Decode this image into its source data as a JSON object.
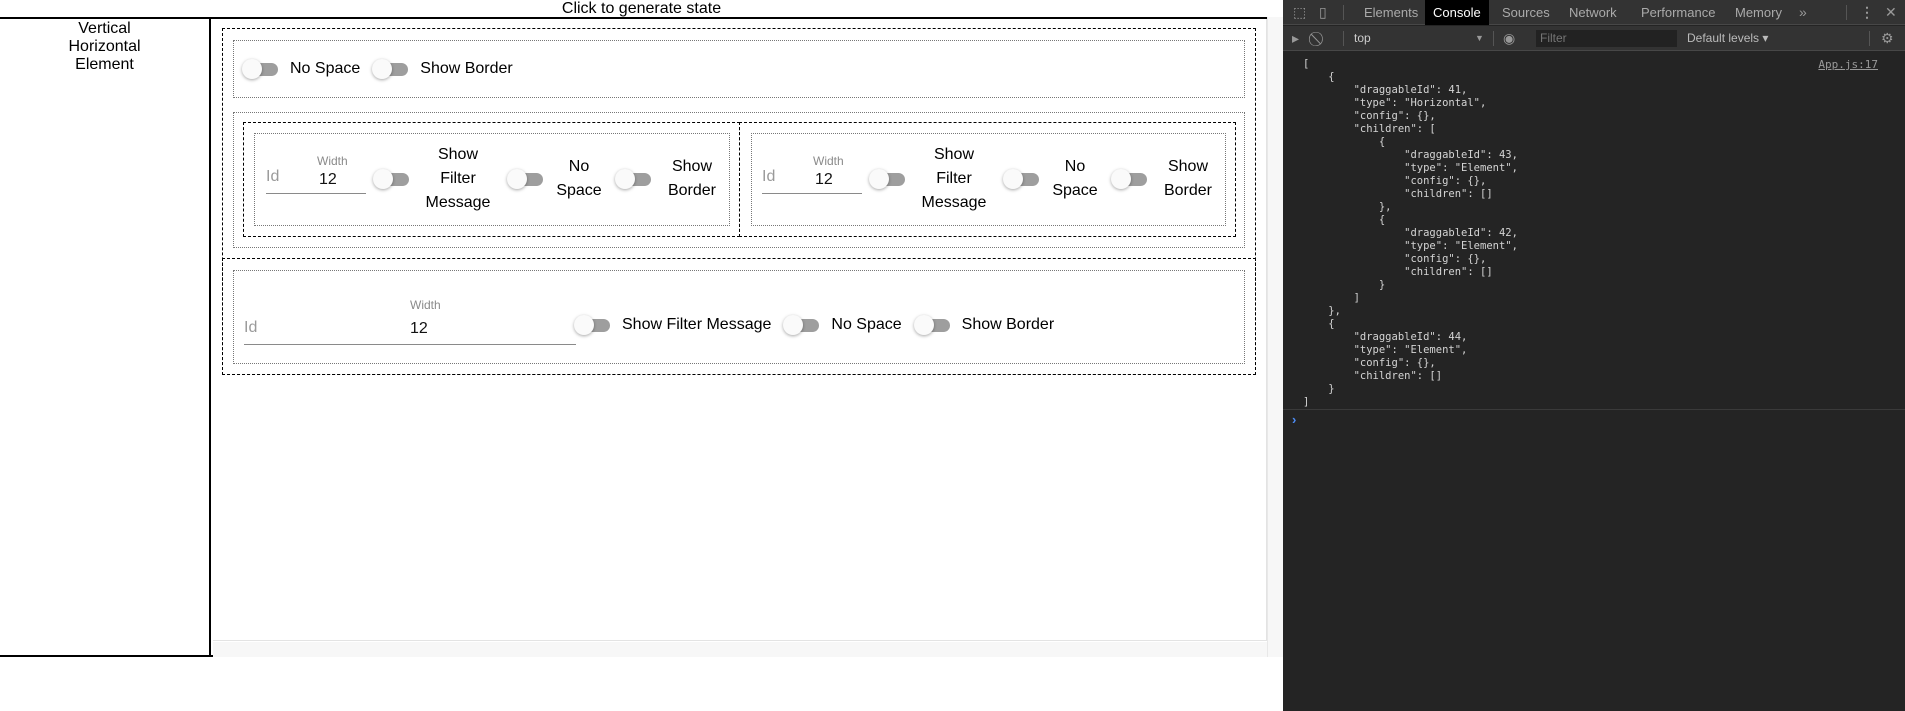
{
  "app": {
    "generate_button": "Click to generate state",
    "palette": [
      "Vertical",
      "Horizontal",
      "Element"
    ],
    "toggles": {
      "no_space": "No Space",
      "show_border": "Show Border",
      "show_filter_message": "Show Filter Message",
      "show_filter_message_wrapped": [
        "Show",
        "Filter",
        "Message"
      ],
      "no_space_wrapped": [
        "No",
        "Space"
      ],
      "show_border_wrapped": [
        "Show",
        "Border"
      ]
    },
    "element_fields": {
      "id_placeholder": "Id",
      "width_label": "Width",
      "width_value": "12"
    },
    "tree": {
      "vertical_root": {
        "toggles": [
          "No Space",
          "Show Border"
        ]
      },
      "horizontal": {
        "draggableId": 41,
        "children": [
          43,
          42
        ]
      },
      "element_bottom": {
        "draggableId": 44
      }
    }
  },
  "devtools": {
    "tabs": [
      "Elements",
      "Console",
      "Sources",
      "Network",
      "Performance",
      "Memory"
    ],
    "active_tab": "Console",
    "more_tabs": "»",
    "context": "top",
    "filter_placeholder": "Filter",
    "levels": "Default levels ▾",
    "source_link": "App.js:17",
    "console_output": "[\n    {\n        \"draggableId\": 41,\n        \"type\": \"Horizontal\",\n        \"config\": {},\n        \"children\": [\n            {\n                \"draggableId\": 43,\n                \"type\": \"Element\",\n                \"config\": {},\n                \"children\": []\n            },\n            {\n                \"draggableId\": 42,\n                \"type\": \"Element\",\n                \"config\": {},\n                \"children\": []\n            }\n        ]\n    },\n    {\n        \"draggableId\": 44,\n        \"type\": \"Element\",\n        \"config\": {},\n        \"children\": []\n    }\n]",
    "prompt": "›"
  }
}
